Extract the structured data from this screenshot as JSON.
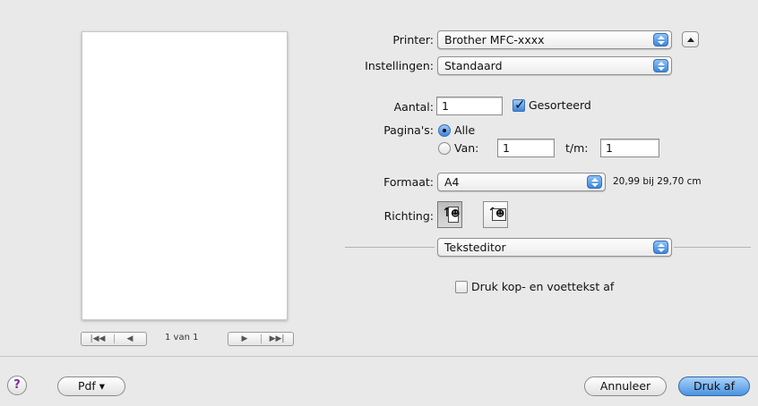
{
  "preview": {
    "page_indicator": "1 van 1",
    "nav_first_icon": "first-page-icon",
    "nav_prev_icon": "previous-page-icon",
    "nav_next_icon": "next-page-icon",
    "nav_last_icon": "last-page-icon"
  },
  "printer": {
    "label": "Printer:",
    "value": "Brother MFC-xxxx"
  },
  "settings": {
    "label": "Instellingen:",
    "value": "Standaard"
  },
  "copies": {
    "label": "Aantal:",
    "value": "1",
    "collate_label": "Gesorteerd",
    "collate_checked": true
  },
  "pages": {
    "label": "Pagina's:",
    "all_label": "Alle",
    "from_label": "Van:",
    "from_value": "1",
    "to_label": "t/m:",
    "to_value": "1",
    "selected": "all"
  },
  "format": {
    "label": "Formaat:",
    "value": "A4",
    "size_text": "20,99 bij 29,70 cm"
  },
  "orientation": {
    "label": "Richting:",
    "selected": "portrait"
  },
  "section_popup": {
    "value": "Teksteditor"
  },
  "header_footer": {
    "label": "Druk kop- en voettekst af",
    "checked": false
  },
  "footer": {
    "help_glyph": "?",
    "pdf_label": "Pdf ▾",
    "cancel_label": "Annuleer",
    "print_label": "Druk af"
  },
  "colors": {
    "accent": "#3b86de",
    "background": "#e9e9e9"
  }
}
